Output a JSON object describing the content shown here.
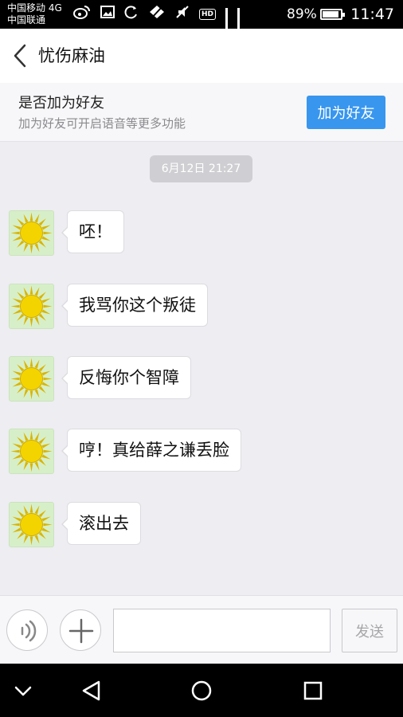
{
  "status_bar": {
    "carrier_1": "中国移动 4G",
    "carrier_2": "中国联通",
    "icons": [
      "weibo-icon",
      "image-icon",
      "sync-icon",
      "location-off-icon",
      "mute-icon",
      "hd-icon",
      "signal-icon"
    ],
    "hd_label": "HD",
    "battery_percent": 89,
    "battery_label": "89%",
    "time": "11:47"
  },
  "header": {
    "title": "忧伤麻油"
  },
  "friend_banner": {
    "title": "是否加为好友",
    "subtitle": "加为好友可开启语音等更多功能",
    "button_label": "加为好友",
    "button_color": "#3896ee"
  },
  "chat": {
    "timestamp": "6月12日 21:27",
    "messages": [
      {
        "text": "呸！"
      },
      {
        "text": "我骂你这个叛徒"
      },
      {
        "text": "反悔你个智障"
      },
      {
        "text": "哼！真给薛之谦丢脸"
      },
      {
        "text": "滚出去"
      }
    ]
  },
  "input_bar": {
    "input_value": "",
    "send_label": "发送"
  },
  "nav_bar": {
    "buttons": [
      "chevron-down-icon",
      "back-triangle-icon",
      "home-circle-icon",
      "recents-square-icon"
    ]
  }
}
